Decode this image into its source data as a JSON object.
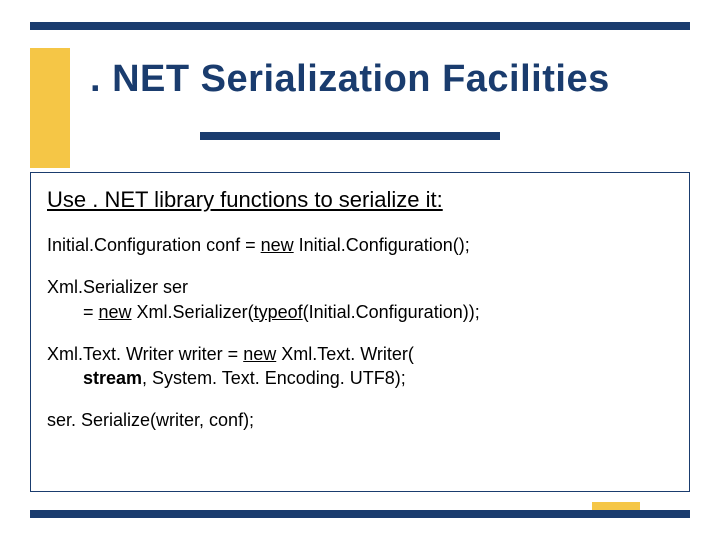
{
  "title": ". NET Serialization Facilities",
  "subhead": "Use . NET library functions to serialize it:",
  "code": {
    "line1_a": "Initial.Configuration conf = ",
    "line1_b": "new",
    "line1_c": " Initial.Configuration();",
    "line2_a": "Xml.Serializer ser",
    "line2_b": "= ",
    "line2_c": "new",
    "line2_d": " Xml.Serializer(",
    "line2_e": "typeof",
    "line2_f": "(Initial.Configuration));",
    "line3_a": "Xml.Text. Writer writer = ",
    "line3_b": "new",
    "line3_c": " Xml.Text. Writer(",
    "line3_d": "stream",
    "line3_e": ", System. Text. Encoding. UTF8);",
    "line4": "ser. Serialize(writer, conf);"
  }
}
